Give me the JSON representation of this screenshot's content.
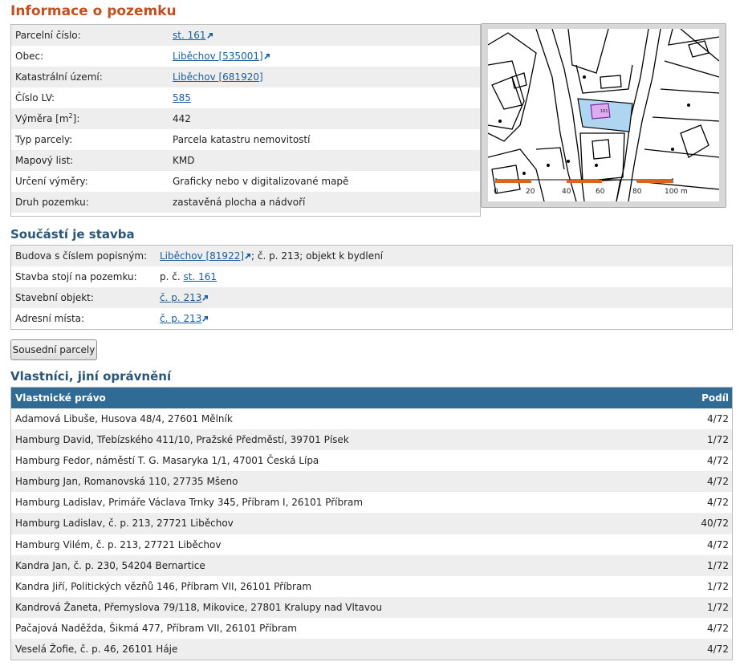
{
  "page_title": "Informace o pozemku",
  "info": {
    "rows": [
      {
        "label": "Parcelní číslo:",
        "value": "st. 161",
        "link": true,
        "ext": true
      },
      {
        "label": "Obec:",
        "value": "Liběchov [535001]",
        "link": true,
        "ext": true
      },
      {
        "label": "Katastrální území:",
        "value": "Liběchov [681920]",
        "link": true,
        "ext": false
      },
      {
        "label": "Číslo LV:",
        "value": "585",
        "link": true,
        "ext": false
      },
      {
        "label": "Výměra [m",
        "label_sup": "2",
        "label_after": "]:",
        "value": "442",
        "link": false
      },
      {
        "label": "Typ parcely:",
        "value": "Parcela katastru nemovitostí",
        "link": false
      },
      {
        "label": "Mapový list:",
        "value": "KMD",
        "link": false
      },
      {
        "label": "Určení výměry:",
        "value": "Graficky nebo v digitalizované mapě",
        "link": false
      },
      {
        "label": "Druh pozemku:",
        "value": "zastavěná plocha a nádvoří",
        "link": false
      }
    ]
  },
  "map": {
    "scale_labels": [
      "0",
      "20",
      "40",
      "60",
      "80",
      "100 m"
    ],
    "parcel_label": "161"
  },
  "stavba": {
    "title": "Součástí je stavba",
    "rows": [
      {
        "label": "Budova s číslem popisným:",
        "link_text": "Liběchov [81922]",
        "suffix": "; č. p. 213; objekt k bydlení"
      },
      {
        "label": "Stavba stojí na pozemku:",
        "prefix": "p. č. ",
        "link_text": "st. 161",
        "suffix": ""
      },
      {
        "label": "Stavební objekt:",
        "link_text": "č. p. 213",
        "suffix": "",
        "ext": true
      },
      {
        "label": "Adresní místa:",
        "link_text": "č. p. 213",
        "suffix": "",
        "ext": true
      }
    ]
  },
  "neighbors_button": "Sousední parcely",
  "owners": {
    "title": "Vlastníci, jiní oprávnění",
    "col_owner": "Vlastnické právo",
    "col_share": "Podíl",
    "rows": [
      {
        "name": "Adamová Libuše, Husova 48/4, 27601 Mělník",
        "share": "4/72"
      },
      {
        "name": "Hamburg David, Třebízského 411/10, Pražské Předměstí, 39701 Písek",
        "share": "1/72"
      },
      {
        "name": "Hamburg Fedor, náměstí T. G. Masaryka 1/1, 47001 Česká Lípa",
        "share": "4/72"
      },
      {
        "name": "Hamburg Jan, Romanovská 110, 27735 Mšeno",
        "share": "4/72"
      },
      {
        "name": "Hamburg Ladislav, Primáře Václava Trnky 345, Příbram I, 26101 Příbram",
        "share": "4/72"
      },
      {
        "name": "Hamburg Ladislav, č. p. 213, 27721 Liběchov",
        "share": "40/72"
      },
      {
        "name": "Hamburg Vilém, č. p. 213, 27721 Liběchov",
        "share": "4/72"
      },
      {
        "name": "Kandra Jan, č. p. 230, 54204 Bernartice",
        "share": "1/72"
      },
      {
        "name": "Kandra Jiří, Politických vězňů 146, Příbram VII, 26101 Příbram",
        "share": "1/72"
      },
      {
        "name": "Kandrová Žaneta, Přemyslova 79/118, Mikovice, 27801 Kralupy nad Vltavou",
        "share": "1/72"
      },
      {
        "name": "Pačajová Naděžda, Šikmá 477, Příbram VII, 26101 Příbram",
        "share": "4/72"
      },
      {
        "name": "Veselá Žofie, č. p. 46, 26101 Háje",
        "share": "4/72"
      }
    ]
  }
}
